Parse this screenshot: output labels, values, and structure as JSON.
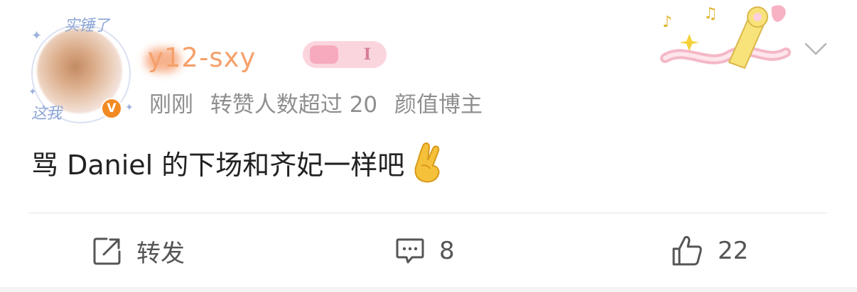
{
  "post": {
    "username": "y12-sxy",
    "badge_label": "I",
    "avatar_deco_top": "实锤了",
    "avatar_deco_bottom": "这我",
    "verified_label": "V",
    "meta": {
      "time": "刚刚",
      "repost_note": "转赞人数超过 20",
      "tag": "颜值博主"
    },
    "text": "骂 Daniel 的下场和齐妃一样吧",
    "emoji": "crossed-fingers-emoji"
  },
  "actions": {
    "repost_label": "转发",
    "comment_count": "8",
    "like_count": "22"
  },
  "colors": {
    "meta_gray": "#8e8e8e",
    "text": "#222222",
    "username": "#f5a06b",
    "verified": "#f28a24",
    "divider": "#e4e4e4"
  }
}
